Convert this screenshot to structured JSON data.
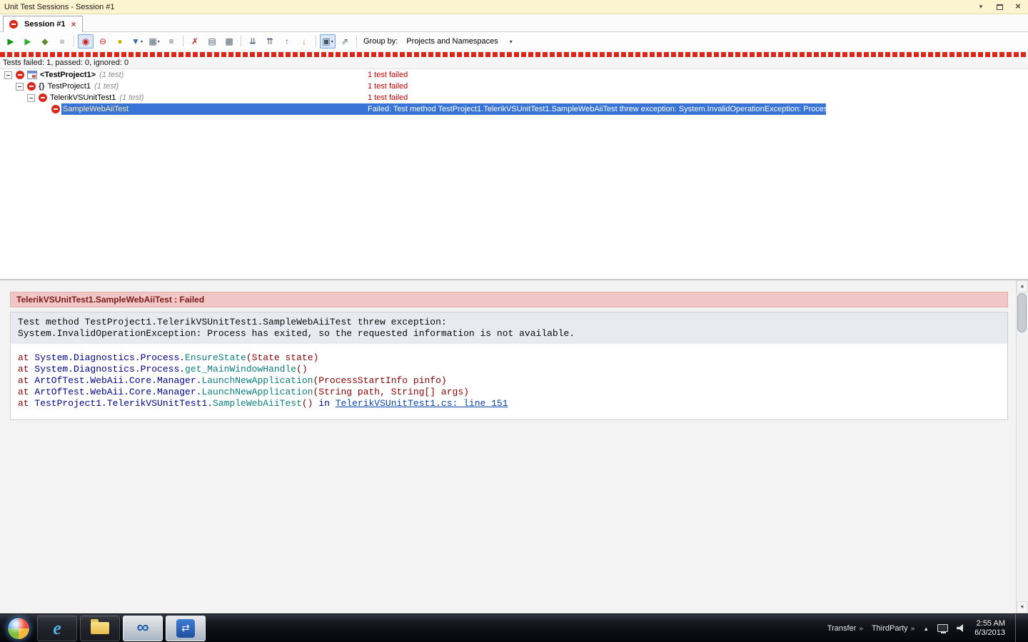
{
  "titlebar": {
    "title": "Unit Test Sessions - Session #1"
  },
  "tab": {
    "label": "Session #1"
  },
  "toolbar": {
    "items": [
      {
        "kind": "button",
        "name": "run-all-tests-button",
        "glyph": "▶",
        "color": "#169416"
      },
      {
        "kind": "button",
        "name": "run-selected-tests-button",
        "glyph": "▶",
        "color": "#33AA33"
      },
      {
        "kind": "button",
        "name": "debug-tests-button",
        "glyph": "◆",
        "color": "#5E8B2F"
      },
      {
        "kind": "button",
        "name": "stop-tests-button",
        "glyph": "■",
        "color": "#9A9A9A",
        "disabled": true
      },
      {
        "kind": "separator"
      },
      {
        "kind": "button",
        "name": "test-status-filter-button",
        "glyph": "◉",
        "color": "#CC2222",
        "pressed": true
      },
      {
        "kind": "button",
        "name": "failed-tests-filter-button",
        "glyph": "⊖",
        "color": "#CC2222"
      },
      {
        "kind": "button",
        "name": "ignored-tests-filter-button",
        "glyph": "●",
        "color": "#C9B200"
      },
      {
        "kind": "button",
        "name": "filter-button",
        "glyph": "▼",
        "color": "#3A6BB5",
        "dropdown": true
      },
      {
        "kind": "button",
        "name": "group-button",
        "glyph": "▦",
        "color": "#556677",
        "dropdown": true
      },
      {
        "kind": "button",
        "name": "sort-button",
        "glyph": "≡",
        "color": "#556677"
      },
      {
        "kind": "separator"
      },
      {
        "kind": "button",
        "name": "remove-session-button",
        "glyph": "✗",
        "color": "#CC2222"
      },
      {
        "kind": "button",
        "name": "export-results-button",
        "glyph": "▤",
        "color": "#556677"
      },
      {
        "kind": "button",
        "name": "copy-results-button",
        "glyph": "▩",
        "color": "#556677"
      },
      {
        "kind": "separator"
      },
      {
        "kind": "button",
        "name": "expand-all-button",
        "glyph": "⇊",
        "color": "#445566"
      },
      {
        "kind": "button",
        "name": "collapse-all-button",
        "glyph": "⇈",
        "color": "#445566"
      },
      {
        "kind": "button",
        "name": "previous-failed-test-button",
        "glyph": "↑",
        "color": "#3377AA"
      },
      {
        "kind": "button",
        "name": "next-failed-test-button",
        "glyph": "↓",
        "color": "#C09030"
      },
      {
        "kind": "separator"
      },
      {
        "kind": "button",
        "name": "output-options-button",
        "glyph": "▣",
        "color": "#445566",
        "dropdown": true,
        "pressed": true
      },
      {
        "kind": "button",
        "name": "open-output-button",
        "glyph": "⇗",
        "color": "#445566"
      },
      {
        "kind": "separator"
      }
    ],
    "group_by_label": "Group by:",
    "group_by_value": "Projects and Namespaces"
  },
  "status_line": {
    "text": "Tests failed: 1, passed: 0, ignored: 0"
  },
  "tree": {
    "rows": [
      {
        "pad": 6,
        "expander": true,
        "type_icon": "project",
        "label": "<TestProject1>",
        "bold": true,
        "suffix": "(1 test)",
        "status": "1 test failed",
        "selected": false
      },
      {
        "pad": 22,
        "expander": true,
        "type_icon": "namespace",
        "label": "TestProject1",
        "bold": false,
        "suffix": "(1 test)",
        "status": "1 test failed",
        "selected": false
      },
      {
        "pad": 38,
        "expander": true,
        "type_icon": "",
        "label": "TelerikVSUnitTest1",
        "bold": false,
        "suffix": "(1 test)",
        "status": "1 test failed",
        "selected": false
      },
      {
        "pad": 72,
        "expander": false,
        "type_icon": "",
        "label": "SampleWebAiiTest",
        "bold": false,
        "suffix": "",
        "status": "Failed: Test method TestProject1.TelerikVSUnitTest1.SampleWebAiiTest threw exception: System.InvalidOperationException: Process",
        "selected": true
      }
    ]
  },
  "details": {
    "header": "TelerikVSUnitTest1.SampleWebAiiTest : Failed",
    "message_lines": [
      "Test method TestProject1.TelerikVSUnitTest1.SampleWebAiiTest threw exception:",
      "System.InvalidOperationException: Process has exited, so the requested information is not available."
    ],
    "stack": [
      [
        {
          "t": "at ",
          "c": "kw"
        },
        {
          "t": "System.Diagnostics.Process.",
          "c": "type"
        },
        {
          "t": "EnsureState",
          "c": "method"
        },
        {
          "t": "(State state)",
          "c": "kw"
        }
      ],
      [
        {
          "t": "at ",
          "c": "kw"
        },
        {
          "t": "System.Diagnostics.Process.",
          "c": "type"
        },
        {
          "t": "get_MainWindowHandle",
          "c": "method"
        },
        {
          "t": "()",
          "c": "kw"
        }
      ],
      [
        {
          "t": "at ",
          "c": "kw"
        },
        {
          "t": "ArtOfTest.WebAii.Core.Manager.",
          "c": "type"
        },
        {
          "t": "LaunchNewApplication",
          "c": "method"
        },
        {
          "t": "(ProcessStartInfo pinfo)",
          "c": "kw"
        }
      ],
      [
        {
          "t": "at ",
          "c": "kw"
        },
        {
          "t": "ArtOfTest.WebAii.Core.Manager.",
          "c": "type"
        },
        {
          "t": "LaunchNewApplication",
          "c": "method"
        },
        {
          "t": "(String path, String[] args)",
          "c": "kw"
        }
      ],
      [
        {
          "t": "at ",
          "c": "kw"
        },
        {
          "t": "TestProject1.TelerikVSUnitTest1.",
          "c": "type"
        },
        {
          "t": "SampleWebAiiTest",
          "c": "method"
        },
        {
          "t": "() ",
          "c": "kw"
        },
        {
          "t": "in ",
          "c": "type"
        },
        {
          "t": "TelerikVSUnitTest1.cs: line 151",
          "c": "link"
        }
      ]
    ]
  },
  "taskbar": {
    "tray": {
      "toolbars": [
        {
          "label": "Transfer"
        },
        {
          "label": "ThirdParty"
        }
      ],
      "time": "2:55 AM",
      "date": "6/3/2013"
    }
  },
  "colors": {
    "selection": "#3874D6",
    "failed_text": "#CC0000",
    "header_bg": "#F0C6C6",
    "header_text": "#7A1A1A",
    "titlebar_bg": "#FBF4CF"
  }
}
